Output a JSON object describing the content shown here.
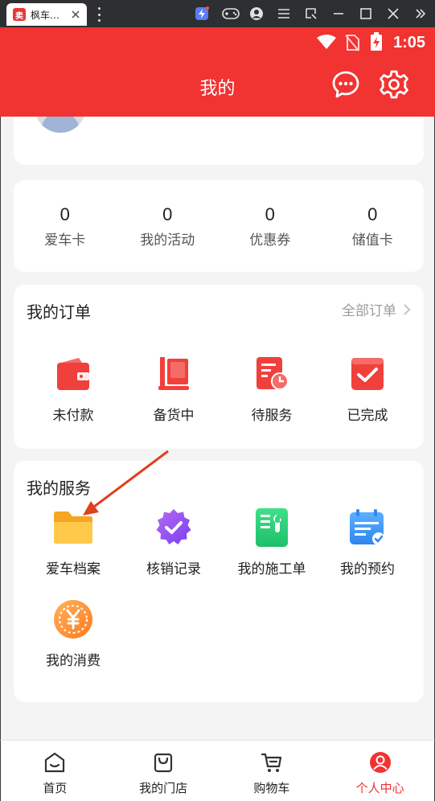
{
  "window": {
    "tab_title": "枫车…",
    "tab_icon_text": "卖"
  },
  "status_bar": {
    "time": "1:05"
  },
  "header": {
    "title": "我的",
    "bg_color": "#f13331"
  },
  "stats": [
    {
      "value": "0",
      "label": "爱车卡"
    },
    {
      "value": "0",
      "label": "我的活动"
    },
    {
      "value": "0",
      "label": "优惠券"
    },
    {
      "value": "0",
      "label": "储值卡"
    }
  ],
  "orders": {
    "title": "我的订单",
    "all_link": "全部订单",
    "items": [
      {
        "label": "未付款",
        "icon": "wallet-icon"
      },
      {
        "label": "备货中",
        "icon": "stock-icon"
      },
      {
        "label": "待服务",
        "icon": "pending-service-icon"
      },
      {
        "label": "已完成",
        "icon": "completed-icon"
      }
    ]
  },
  "services": {
    "title": "我的服务",
    "items": [
      {
        "label": "爱车档案",
        "icon": "folder-icon"
      },
      {
        "label": "核销记录",
        "icon": "verified-badge-icon"
      },
      {
        "label": "我的施工单",
        "icon": "work-order-icon"
      },
      {
        "label": "我的预约",
        "icon": "calendar-icon"
      },
      {
        "label": "我的消费",
        "icon": "yuan-coin-icon"
      }
    ]
  },
  "bottom_nav": [
    {
      "label": "首页",
      "icon": "home-icon",
      "active": false
    },
    {
      "label": "我的门店",
      "icon": "shopping-bag-icon",
      "active": false
    },
    {
      "label": "购物车",
      "icon": "cart-icon",
      "active": false
    },
    {
      "label": "个人中心",
      "icon": "user-center-icon",
      "active": true
    }
  ]
}
